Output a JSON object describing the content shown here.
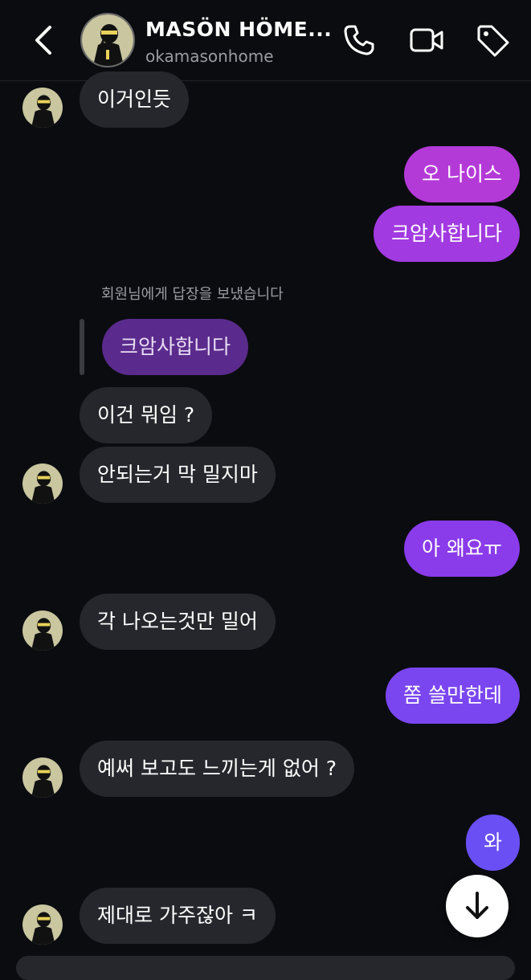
{
  "header": {
    "name": "MASÖN HÖME...",
    "username": "okamasonhome",
    "icons": [
      "back-arrow-icon",
      "phone-icon",
      "video-icon",
      "tag-icon"
    ]
  },
  "reply_notice": "회원님에게 답장을 보냈습니다",
  "messages": [
    {
      "side": "received",
      "text": "이거인듯"
    },
    {
      "side": "sent",
      "text": "오 나이스"
    },
    {
      "side": "sent",
      "text": "크암사합니다"
    },
    {
      "side": "replied-quote",
      "text": "크암사합니다"
    },
    {
      "side": "received",
      "text": "이건 뭐임 ?"
    },
    {
      "side": "received",
      "text": "안되는거 막 밀지마"
    },
    {
      "side": "sent",
      "text": "아 왜요ㅠ"
    },
    {
      "side": "received",
      "text": "각 나오는것만 밀어"
    },
    {
      "side": "sent",
      "text": "쫌 쓸만한데"
    },
    {
      "side": "received",
      "text": "예써 보고도 느끼는게 없어 ?"
    },
    {
      "side": "sent",
      "text": "와"
    },
    {
      "side": "received",
      "text": "제대로 가주잖아 ㅋ"
    }
  ],
  "colors": {
    "background": "#0b0c10",
    "received_bubble": "#26272c",
    "sent_gradient": [
      "#b43ad8",
      "#9838e6",
      "#7a46f0",
      "#6a4ff5"
    ],
    "reply_bubble": "#5a2b8c"
  },
  "scroll_button_icon": "arrow-down-icon"
}
